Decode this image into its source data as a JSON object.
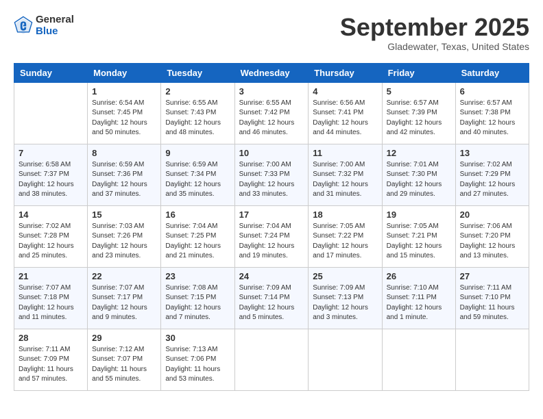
{
  "header": {
    "logo_general": "General",
    "logo_blue": "Blue",
    "month": "September 2025",
    "location": "Gladewater, Texas, United States"
  },
  "days_of_week": [
    "Sunday",
    "Monday",
    "Tuesday",
    "Wednesday",
    "Thursday",
    "Friday",
    "Saturday"
  ],
  "weeks": [
    [
      {
        "day": "",
        "sunrise": "",
        "sunset": "",
        "daylight": ""
      },
      {
        "day": "1",
        "sunrise": "Sunrise: 6:54 AM",
        "sunset": "Sunset: 7:45 PM",
        "daylight": "Daylight: 12 hours and 50 minutes."
      },
      {
        "day": "2",
        "sunrise": "Sunrise: 6:55 AM",
        "sunset": "Sunset: 7:43 PM",
        "daylight": "Daylight: 12 hours and 48 minutes."
      },
      {
        "day": "3",
        "sunrise": "Sunrise: 6:55 AM",
        "sunset": "Sunset: 7:42 PM",
        "daylight": "Daylight: 12 hours and 46 minutes."
      },
      {
        "day": "4",
        "sunrise": "Sunrise: 6:56 AM",
        "sunset": "Sunset: 7:41 PM",
        "daylight": "Daylight: 12 hours and 44 minutes."
      },
      {
        "day": "5",
        "sunrise": "Sunrise: 6:57 AM",
        "sunset": "Sunset: 7:39 PM",
        "daylight": "Daylight: 12 hours and 42 minutes."
      },
      {
        "day": "6",
        "sunrise": "Sunrise: 6:57 AM",
        "sunset": "Sunset: 7:38 PM",
        "daylight": "Daylight: 12 hours and 40 minutes."
      }
    ],
    [
      {
        "day": "7",
        "sunrise": "Sunrise: 6:58 AM",
        "sunset": "Sunset: 7:37 PM",
        "daylight": "Daylight: 12 hours and 38 minutes."
      },
      {
        "day": "8",
        "sunrise": "Sunrise: 6:59 AM",
        "sunset": "Sunset: 7:36 PM",
        "daylight": "Daylight: 12 hours and 37 minutes."
      },
      {
        "day": "9",
        "sunrise": "Sunrise: 6:59 AM",
        "sunset": "Sunset: 7:34 PM",
        "daylight": "Daylight: 12 hours and 35 minutes."
      },
      {
        "day": "10",
        "sunrise": "Sunrise: 7:00 AM",
        "sunset": "Sunset: 7:33 PM",
        "daylight": "Daylight: 12 hours and 33 minutes."
      },
      {
        "day": "11",
        "sunrise": "Sunrise: 7:00 AM",
        "sunset": "Sunset: 7:32 PM",
        "daylight": "Daylight: 12 hours and 31 minutes."
      },
      {
        "day": "12",
        "sunrise": "Sunrise: 7:01 AM",
        "sunset": "Sunset: 7:30 PM",
        "daylight": "Daylight: 12 hours and 29 minutes."
      },
      {
        "day": "13",
        "sunrise": "Sunrise: 7:02 AM",
        "sunset": "Sunset: 7:29 PM",
        "daylight": "Daylight: 12 hours and 27 minutes."
      }
    ],
    [
      {
        "day": "14",
        "sunrise": "Sunrise: 7:02 AM",
        "sunset": "Sunset: 7:28 PM",
        "daylight": "Daylight: 12 hours and 25 minutes."
      },
      {
        "day": "15",
        "sunrise": "Sunrise: 7:03 AM",
        "sunset": "Sunset: 7:26 PM",
        "daylight": "Daylight: 12 hours and 23 minutes."
      },
      {
        "day": "16",
        "sunrise": "Sunrise: 7:04 AM",
        "sunset": "Sunset: 7:25 PM",
        "daylight": "Daylight: 12 hours and 21 minutes."
      },
      {
        "day": "17",
        "sunrise": "Sunrise: 7:04 AM",
        "sunset": "Sunset: 7:24 PM",
        "daylight": "Daylight: 12 hours and 19 minutes."
      },
      {
        "day": "18",
        "sunrise": "Sunrise: 7:05 AM",
        "sunset": "Sunset: 7:22 PM",
        "daylight": "Daylight: 12 hours and 17 minutes."
      },
      {
        "day": "19",
        "sunrise": "Sunrise: 7:05 AM",
        "sunset": "Sunset: 7:21 PM",
        "daylight": "Daylight: 12 hours and 15 minutes."
      },
      {
        "day": "20",
        "sunrise": "Sunrise: 7:06 AM",
        "sunset": "Sunset: 7:20 PM",
        "daylight": "Daylight: 12 hours and 13 minutes."
      }
    ],
    [
      {
        "day": "21",
        "sunrise": "Sunrise: 7:07 AM",
        "sunset": "Sunset: 7:18 PM",
        "daylight": "Daylight: 12 hours and 11 minutes."
      },
      {
        "day": "22",
        "sunrise": "Sunrise: 7:07 AM",
        "sunset": "Sunset: 7:17 PM",
        "daylight": "Daylight: 12 hours and 9 minutes."
      },
      {
        "day": "23",
        "sunrise": "Sunrise: 7:08 AM",
        "sunset": "Sunset: 7:15 PM",
        "daylight": "Daylight: 12 hours and 7 minutes."
      },
      {
        "day": "24",
        "sunrise": "Sunrise: 7:09 AM",
        "sunset": "Sunset: 7:14 PM",
        "daylight": "Daylight: 12 hours and 5 minutes."
      },
      {
        "day": "25",
        "sunrise": "Sunrise: 7:09 AM",
        "sunset": "Sunset: 7:13 PM",
        "daylight": "Daylight: 12 hours and 3 minutes."
      },
      {
        "day": "26",
        "sunrise": "Sunrise: 7:10 AM",
        "sunset": "Sunset: 7:11 PM",
        "daylight": "Daylight: 12 hours and 1 minute."
      },
      {
        "day": "27",
        "sunrise": "Sunrise: 7:11 AM",
        "sunset": "Sunset: 7:10 PM",
        "daylight": "Daylight: 11 hours and 59 minutes."
      }
    ],
    [
      {
        "day": "28",
        "sunrise": "Sunrise: 7:11 AM",
        "sunset": "Sunset: 7:09 PM",
        "daylight": "Daylight: 11 hours and 57 minutes."
      },
      {
        "day": "29",
        "sunrise": "Sunrise: 7:12 AM",
        "sunset": "Sunset: 7:07 PM",
        "daylight": "Daylight: 11 hours and 55 minutes."
      },
      {
        "day": "30",
        "sunrise": "Sunrise: 7:13 AM",
        "sunset": "Sunset: 7:06 PM",
        "daylight": "Daylight: 11 hours and 53 minutes."
      },
      {
        "day": "",
        "sunrise": "",
        "sunset": "",
        "daylight": ""
      },
      {
        "day": "",
        "sunrise": "",
        "sunset": "",
        "daylight": ""
      },
      {
        "day": "",
        "sunrise": "",
        "sunset": "",
        "daylight": ""
      },
      {
        "day": "",
        "sunrise": "",
        "sunset": "",
        "daylight": ""
      }
    ]
  ]
}
